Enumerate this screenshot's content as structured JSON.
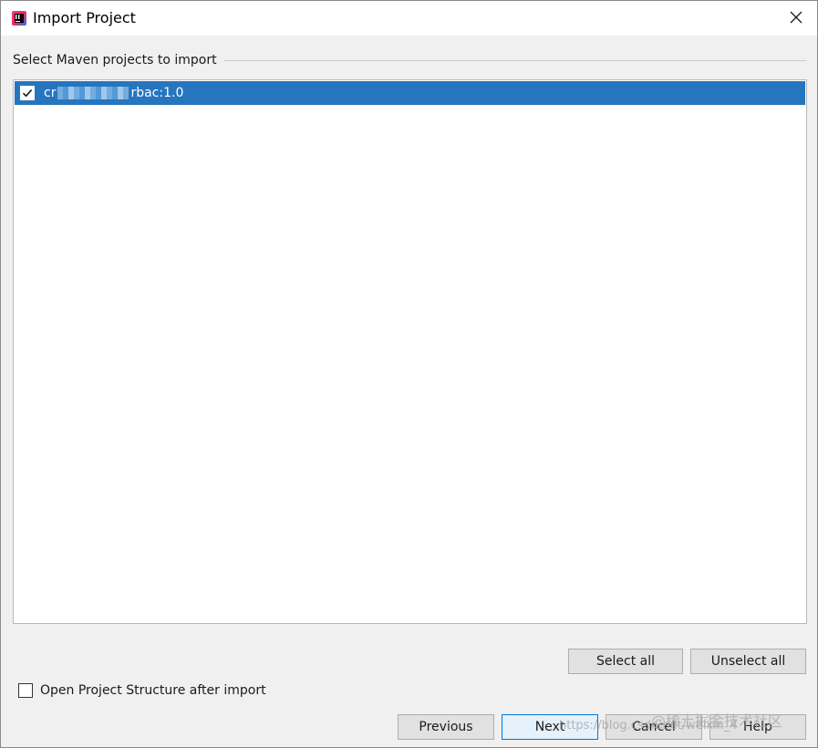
{
  "window": {
    "title": "Import Project",
    "close_symbol": "✕"
  },
  "section": {
    "label": "Select Maven projects to import"
  },
  "projects": [
    {
      "prefix": "cr",
      "suffix": "rbac:1.0",
      "checked": true
    }
  ],
  "buttons": {
    "select_all": "Select all",
    "unselect_all": "Unselect all",
    "previous": "Previous",
    "next": "Next",
    "cancel": "Cancel",
    "help": "Help"
  },
  "options": {
    "open_structure_label": "Open Project Structure after import",
    "open_structure_checked": false
  },
  "watermark": {
    "url_text": "https://blog.csdn.net/weixin_4",
    "site_text": "@稀土掘金技术社区"
  },
  "colors": {
    "selection": "#2675bf",
    "background": "#f0f0f0",
    "primary_border": "#0078d7"
  },
  "icons": {
    "app": "intellij-idea-icon",
    "close": "close-icon",
    "check": "checkmark-icon"
  }
}
